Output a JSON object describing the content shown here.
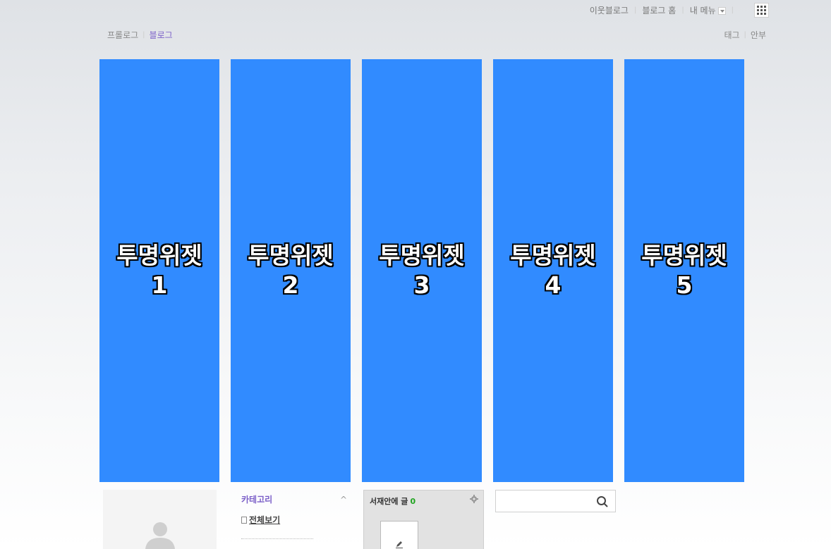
{
  "topbar": {
    "neighbor_blog": "이웃블로그",
    "blog_home": "블로그 홈",
    "my_menu": "내 메뉴"
  },
  "subnav": {
    "prologue": "프롤로그",
    "blog": "블로그"
  },
  "rightnav": {
    "tag": "태그",
    "guestbook": "안부"
  },
  "widgets": [
    {
      "title": "투명위젯",
      "number": "1"
    },
    {
      "title": "투명위젯",
      "number": "2"
    },
    {
      "title": "투명위젯",
      "number": "3"
    },
    {
      "title": "투명위젯",
      "number": "4"
    },
    {
      "title": "투명위젯",
      "number": "5"
    }
  ],
  "category": {
    "title": "카테고리",
    "collapse_glyph": "^",
    "view_all": "전체보기"
  },
  "drawer": {
    "title": "서재안에 글",
    "count": "0"
  },
  "search": {
    "value": ""
  },
  "colors": {
    "widget_blue": "#318bff",
    "accent_purple": "#7b5fc8",
    "count_green": "#1fa41f"
  }
}
